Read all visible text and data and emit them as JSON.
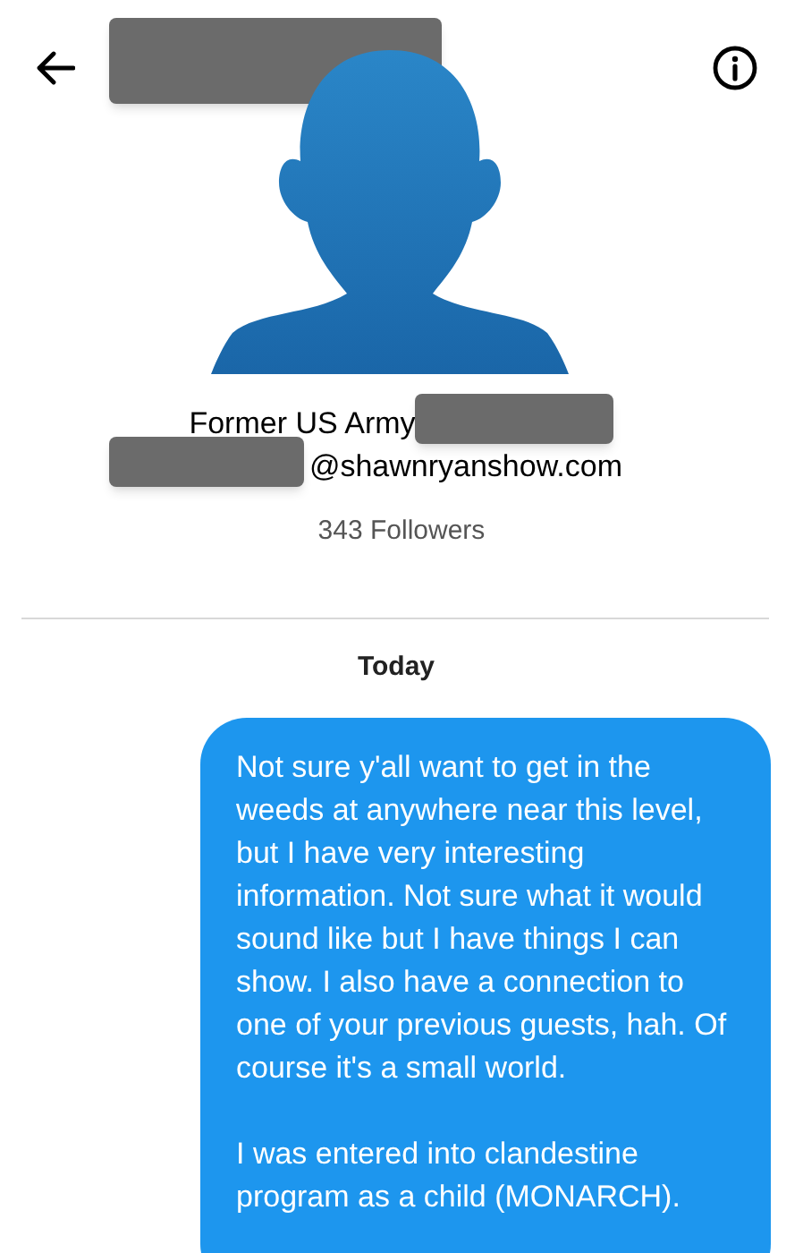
{
  "profile": {
    "bio": "Former US Army",
    "email": "@shawnryanshow.com",
    "followers": "343 Followers"
  },
  "date_divider": "Today",
  "messages": [
    {
      "kind": "sent",
      "paragraphs": [
        "Not sure y'all want to get in the weeds at anywhere near this level, but I have very interesting information. Not sure what it would sound like but I have things I can show. I also have a connection to one of your previous guests, hah. Of course it's a small world.",
        "I was entered into clandestine program as a child (MONARCH)."
      ]
    }
  ]
}
